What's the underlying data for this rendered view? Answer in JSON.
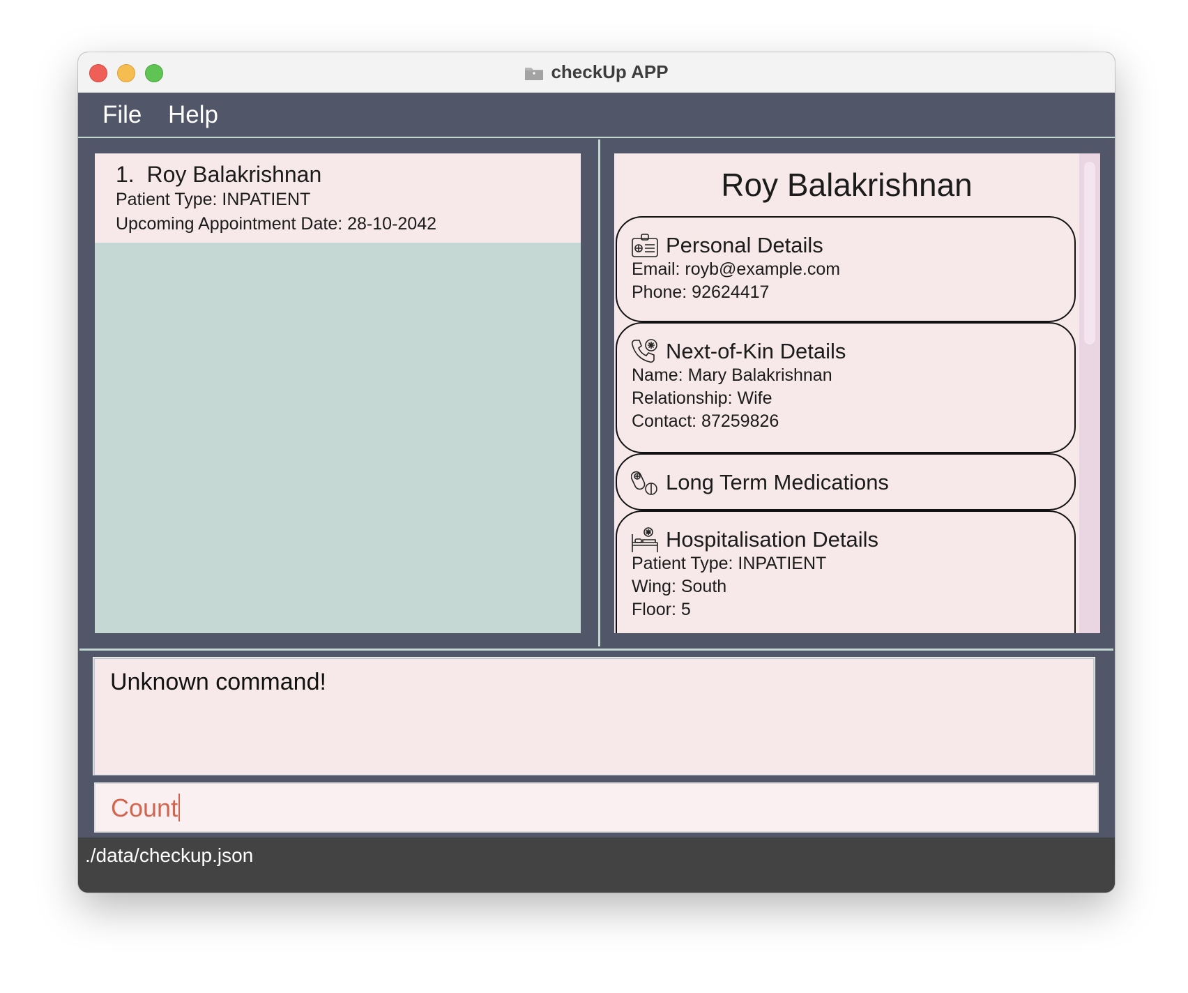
{
  "window": {
    "title": "checkUp APP"
  },
  "menu": {
    "file": "File",
    "help": "Help"
  },
  "patient_list": {
    "items": [
      {
        "index": "1.",
        "name": "Roy Balakrishnan",
        "patient_type": "Patient Type: INPATIENT",
        "appointment": "Upcoming Appointment Date: 28-10-2042"
      }
    ]
  },
  "details": {
    "name": "Roy Balakrishnan",
    "personal": {
      "title": "Personal Details",
      "email": "Email: royb@example.com",
      "phone": "Phone: 92624417"
    },
    "next_of_kin": {
      "title": "Next-of-Kin Details",
      "name": "Name: Mary Balakrishnan",
      "relationship": "Relationship: Wife",
      "contact": "Contact: 87259826"
    },
    "medications": {
      "title": "Long Term Medications"
    },
    "hospitalisation": {
      "title": "Hospitalisation Details",
      "patient_type": "Patient Type: INPATIENT",
      "wing": "Wing: South",
      "floor": "Floor: 5"
    }
  },
  "result_display": {
    "text": "Unknown command!"
  },
  "command_box": {
    "value": "Count"
  },
  "status_bar": {
    "path": "./data/checkup.json"
  },
  "icons": {
    "title": "folder-icon",
    "personal": "id-card-icon",
    "next_of_kin": "phone-icon",
    "medications": "pills-icon",
    "hospitalisation": "hospital-bed-icon"
  },
  "colors": {
    "panel_bg": "#525669",
    "card_bg": "#f7e9ea",
    "list_bg": "#c5d8d4",
    "command_text": "#d3654e",
    "status_bg": "#434343"
  }
}
